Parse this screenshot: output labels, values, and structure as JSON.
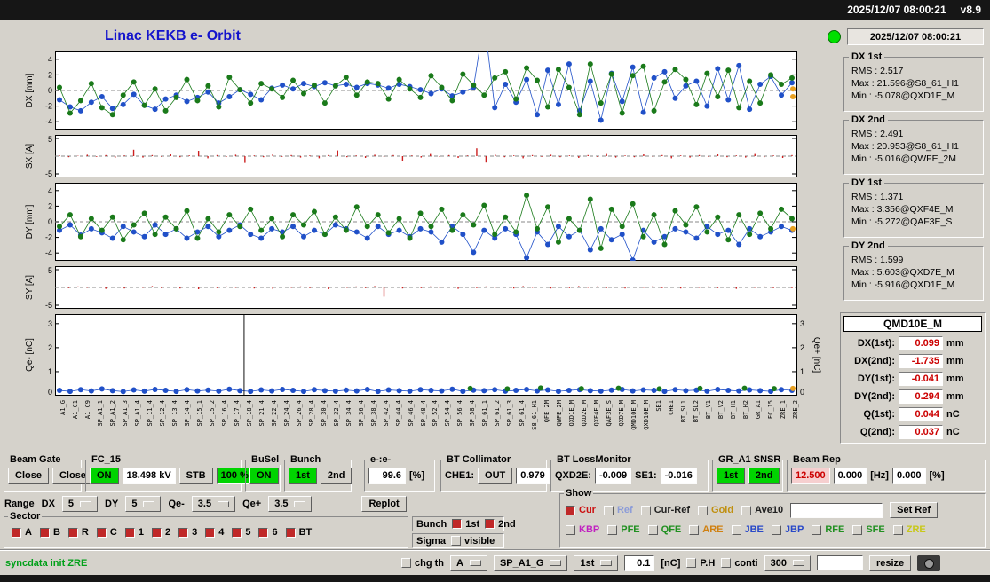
{
  "titlebar": {
    "datetime": "2025/12/07 08:00:21",
    "version": "v8.9"
  },
  "header": {
    "title": "Linac KEKB e- Orbit",
    "timestamp": "2025/12/07 08:00:21"
  },
  "stats": [
    {
      "name": "DX 1st",
      "rms": "RMS : 2.517",
      "max": "Max : 21.596@S8_61_H1",
      "min": "Min : -5.078@QXD1E_M"
    },
    {
      "name": "DX 2nd",
      "rms": "RMS : 2.491",
      "max": "Max : 20.953@S8_61_H1",
      "min": "Min : -5.016@QWFE_2M"
    },
    {
      "name": "DY 1st",
      "rms": "RMS : 1.371",
      "max": "Max : 3.356@QXF4E_M",
      "min": "Min : -5.272@QAF3E_S"
    },
    {
      "name": "DY 2nd",
      "rms": "RMS : 1.599",
      "max": "Max : 5.603@QXD7E_M",
      "min": "Min : -5.916@QXD1E_M"
    }
  ],
  "monitor": {
    "title": "QMD10E_M",
    "rows": [
      {
        "label": "DX(1st):",
        "value": "0.099",
        "unit": "mm"
      },
      {
        "label": "DX(2nd):",
        "value": "-1.735",
        "unit": "mm"
      },
      {
        "label": "DY(1st):",
        "value": "-0.041",
        "unit": "mm"
      },
      {
        "label": "DY(2nd):",
        "value": "0.294",
        "unit": "mm"
      },
      {
        "label": "Q(1st):",
        "value": "0.044",
        "unit": "nC"
      },
      {
        "label": "Q(2nd):",
        "value": "0.037",
        "unit": "nC"
      }
    ]
  },
  "controls": {
    "beam_gate": {
      "title": "Beam Gate",
      "btn1": "Close",
      "btn2": "Close"
    },
    "fc15": {
      "title": "FC_15",
      "on": "ON",
      "kv": "18.498 kV",
      "stb": "STB",
      "pct": "100 %"
    },
    "busel": {
      "title": "BuSel",
      "on": "ON"
    },
    "bunch": {
      "title": "Bunch",
      "b1": "1st",
      "b2": "2nd"
    },
    "ee": {
      "title": "e-:e-",
      "value": "99.6",
      "unit": "[%]"
    },
    "bt_collimator": {
      "title": "BT Collimator",
      "che1_label": "CHE1:",
      "che1": "OUT",
      "value": "0.979"
    },
    "bt_lossmonitor": {
      "title": "BT LossMonitor",
      "qxd2e_label": "QXD2E:",
      "qxd2e": "-0.009",
      "se1_label": "SE1:",
      "se1": "-0.016"
    },
    "gr_a1": {
      "title": "GR_A1 SNSR",
      "b1": "1st",
      "b2": "2nd"
    },
    "beam_rep": {
      "title": "Beam Rep",
      "rep": "12.500",
      "v2": "0.000",
      "hz": "[Hz]",
      "v3": "0.000",
      "pct": "[%]"
    },
    "range": {
      "label": "Range",
      "dx_label": "DX",
      "dx": "5",
      "dy_label": "DY",
      "dy": "5",
      "qem_label": "Qe-",
      "qem": "3.5",
      "qep_label": "Qe+",
      "qep": "3.5",
      "replot": "Replot"
    },
    "sector": {
      "title": "Sector",
      "items": [
        {
          "label": "A",
          "checked": true
        },
        {
          "label": "B",
          "checked": true
        },
        {
          "label": "R",
          "checked": true
        },
        {
          "label": "C",
          "checked": true
        },
        {
          "label": "1",
          "checked": true
        },
        {
          "label": "2",
          "checked": true
        },
        {
          "label": "3",
          "checked": true
        },
        {
          "label": "4",
          "checked": true
        },
        {
          "label": "5",
          "checked": true
        },
        {
          "label": "6",
          "checked": true
        },
        {
          "label": "BT",
          "checked": true
        }
      ]
    },
    "bunch_sel": {
      "title": "Bunch",
      "items": [
        {
          "label": "1st",
          "checked": true
        },
        {
          "label": "2nd",
          "checked": true
        }
      ]
    },
    "sigma": {
      "title": "Sigma",
      "items": [
        {
          "label": "visible",
          "checked": false
        }
      ]
    },
    "show": {
      "title": "Show",
      "row1": [
        {
          "label": "Cur",
          "color": "#cc1010",
          "checked": true
        },
        {
          "label": "Ref",
          "color": "#8c9cd8",
          "checked": false
        },
        {
          "label": "Cur-Ref",
          "color": "#202020",
          "checked": false
        },
        {
          "label": "Gold",
          "color": "#c09010",
          "checked": false
        },
        {
          "label": "Ave10",
          "color": "#202020",
          "checked": false
        }
      ],
      "set_ref": "Set Ref",
      "row2": [
        {
          "label": "KBP",
          "color": "#c020c0",
          "checked": false
        },
        {
          "label": "PFE",
          "color": "#209020",
          "checked": false
        },
        {
          "label": "QFE",
          "color": "#209020",
          "checked": false
        },
        {
          "label": "ARE",
          "color": "#d08010",
          "checked": false
        },
        {
          "label": "JBE",
          "color": "#2848c8",
          "checked": false
        },
        {
          "label": "JBP",
          "color": "#2848c8",
          "checked": false
        },
        {
          "label": "RFE",
          "color": "#209020",
          "checked": false
        },
        {
          "label": "SFE",
          "color": "#209020",
          "checked": false
        },
        {
          "label": "ZRE",
          "color": "#c8c818",
          "checked": false
        }
      ]
    },
    "statusbar": {
      "message": "syncdata init ZRE",
      "chg_th": "chg th",
      "mode": "A",
      "device": "SP_A1_G",
      "bunch": "1st",
      "threshold": "0.1",
      "unit": "[nC]",
      "ph": "P.H",
      "conti": "conti",
      "interval": "300",
      "resize": "resize"
    }
  },
  "xaxis_labels": [
    "A1_G",
    "A1_C1",
    "A1_C9",
    "SP_A1_1",
    "SP_A1_2",
    "SP_A1_3",
    "SP_A1_4",
    "SP_11_4",
    "SP_12_4",
    "SP_13_4",
    "SP_14_4",
    "SP_15_1",
    "SP_15_2",
    "SP_16_4",
    "SP_17_4",
    "SP_18_4",
    "SP_21_4",
    "SP_22_4",
    "SP_24_4",
    "SP_26_4",
    "SP_28_4",
    "SP_30_4",
    "SP_32_4",
    "SP_34_4",
    "SP_36_4",
    "SP_38_4",
    "SP_42_4",
    "SP_44_4",
    "SP_46_4",
    "SP_48_4",
    "SP_52_4",
    "SP_54_4",
    "SP_56_4",
    "SP_58_4",
    "SP_61_1",
    "SP_61_2",
    "SP_61_3",
    "SP_61_4",
    "S8_61_H1",
    "QFE_2M",
    "QWFE_2M",
    "QXD1E_M",
    "QXD2E_M",
    "QXF4E_M",
    "QAF3E_S",
    "QXD7E_M",
    "QMD10E_M",
    "QXD10E_M",
    "SE1",
    "CHE1",
    "BT_SL1",
    "BT_SL2",
    "BT_V1",
    "BT_V2",
    "BT_H1",
    "BT_H2",
    "GR_A1",
    "FC_15",
    "ZRE_1",
    "ZRE_2"
  ],
  "chart_data": [
    {
      "id": "dx",
      "type": "scatter",
      "axis_title": "DX [mm]",
      "ylim": [
        -5,
        5
      ],
      "yticks": [
        4,
        2,
        0,
        -2,
        -4
      ],
      "series": [
        {
          "name": "e- orbit 1st bunch",
          "color": "#2050c8",
          "values": [
            -1.2,
            -2.1,
            -2.6,
            -1.5,
            -0.8,
            -2.3,
            -1.8,
            -0.5,
            -1.9,
            -2.4,
            -1.1,
            -0.6,
            -1.4,
            -0.9,
            -0.2,
            -1.6,
            -0.8,
            0.1,
            -0.5,
            -1.2,
            0.3,
            0.7,
            0.2,
            0.9,
            0.5,
            1.0,
            0.6,
            0.8,
            0.4,
            0.9,
            0.7,
            0.3,
            0.8,
            0.5,
            0.1,
            -0.4,
            0.2,
            -0.7,
            -0.2,
            0.4,
            9.0,
            -2.2,
            0.8,
            -1.5,
            1.4,
            -3.1,
            2.6,
            -1.8,
            3.4,
            -2.6,
            1.2,
            -3.8,
            2.2,
            -1.4,
            3.0,
            -2.8,
            1.6,
            2.4,
            -1.0,
            0.6,
            1.2,
            -2.0,
            2.8,
            -1.2,
            3.2,
            -2.4,
            0.8,
            1.8,
            -0.6,
            1.0
          ]
        },
        {
          "name": "e- orbit 2nd bunch",
          "color": "#1a7a1a",
          "values": [
            0.4,
            -2.9,
            -1.3,
            0.9,
            -2.2,
            -3.1,
            -0.6,
            1.1,
            -1.9,
            0.2,
            -2.6,
            -0.9,
            1.4,
            -1.3,
            0.6,
            -2.1,
            1.7,
            0.1,
            -1.6,
            0.9,
            0.2,
            -0.9,
            1.3,
            -0.4,
            0.7,
            -1.6,
            0.6,
            1.7,
            -0.6,
            1.1,
            0.9,
            -1.1,
            1.4,
            0.2,
            -0.9,
            1.9,
            0.4,
            -1.3,
            2.1,
            0.7,
            -0.6,
            1.6,
            2.4,
            -1.1,
            2.9,
            1.3,
            -2.1,
            2.7,
            0.4,
            -3.1,
            3.4,
            -1.6,
            2.1,
            -2.9,
            1.9,
            3.1,
            -2.6,
            1.1,
            2.7,
            1.4,
            -1.8,
            2.2,
            -0.8,
            2.6,
            -2.2,
            1.2,
            -1.6,
            2.0,
            0.8,
            1.6
          ]
        }
      ],
      "end_markers": [
        0.2,
        -0.8
      ]
    },
    {
      "id": "sx",
      "type": "bar",
      "axis_title": "SX [A]",
      "ylim": [
        -6,
        6
      ],
      "yticks": [
        5,
        -5
      ],
      "color": "#cc2020",
      "bar_values": [
        0.2,
        -0.3,
        0.1,
        0.4,
        -0.2,
        0.3,
        -0.5,
        0.2,
        1.8,
        -0.4,
        0.3,
        -0.2,
        0.5,
        -0.3,
        0.2,
        1.5,
        -0.6,
        0.3,
        -0.2,
        0.4,
        -1.9,
        0.2,
        -0.3,
        0.5,
        -0.2,
        0.3,
        -0.4,
        0.2,
        -0.6,
        0.3,
        1.6,
        -0.3,
        0.2,
        -0.5,
        0.4,
        -0.2,
        0.3,
        -1.5,
        0.2,
        -0.4,
        0.6,
        -0.2,
        0.3,
        -0.5,
        0.2,
        2.2,
        -1.8,
        0.4,
        -0.3,
        0.2,
        -0.6,
        0.3,
        -0.2,
        0.4,
        -0.3,
        0.2,
        -0.5,
        0.3,
        -0.2,
        0.6,
        -0.4,
        0.2,
        -0.3,
        0.5,
        -0.2,
        0.3,
        -0.6,
        0.2,
        -0.4,
        0.3,
        -0.2,
        0.5,
        -0.3,
        0.2,
        -0.4,
        0.6,
        -0.3,
        0.2,
        -0.5,
        0.3
      ]
    },
    {
      "id": "dy",
      "type": "scatter",
      "axis_title": "DY [mm]",
      "ylim": [
        -5,
        5
      ],
      "yticks": [
        4,
        2,
        0,
        -2,
        -4
      ],
      "series": [
        {
          "name": "e- orbit 1st bunch",
          "color": "#2050c8",
          "values": [
            -1.1,
            -0.4,
            -1.7,
            -0.9,
            -1.4,
            -2.1,
            -0.6,
            -1.3,
            -1.9,
            -0.4,
            -1.6,
            -0.9,
            -2.1,
            -1.3,
            -0.6,
            -1.9,
            -1.1,
            -0.4,
            -1.6,
            -2.1,
            -0.9,
            -1.3,
            -0.6,
            -1.9,
            -1.1,
            -1.6,
            -0.4,
            -0.9,
            -1.3,
            -2.1,
            -0.6,
            -1.6,
            -1.1,
            -1.9,
            -0.9,
            -1.3,
            -2.6,
            -0.6,
            -1.6,
            -3.9,
            -1.1,
            -2.1,
            -0.9,
            -1.6,
            -4.6,
            -1.3,
            -2.9,
            -0.6,
            -1.9,
            -1.1,
            -3.6,
            -0.9,
            -2.3,
            -1.6,
            -4.9,
            -1.1,
            -2.6,
            -1.9,
            -0.9,
            -1.3,
            -2.1,
            -0.6,
            -1.6,
            -1.1,
            -2.9,
            -0.9,
            -1.9,
            -1.3,
            -0.6,
            -1.1
          ]
        },
        {
          "name": "e- orbit 2nd bunch",
          "color": "#1a7a1a",
          "values": [
            -0.6,
            0.9,
            -1.9,
            0.4,
            -1.1,
            0.6,
            -2.3,
            -0.4,
            1.1,
            -1.6,
            0.6,
            -0.9,
            1.4,
            -2.1,
            0.4,
            -1.3,
            0.9,
            -0.6,
            1.6,
            -1.1,
            0.4,
            -1.9,
            0.9,
            -0.4,
            1.3,
            -1.6,
            0.6,
            -1.1,
            1.9,
            -0.6,
            0.9,
            -1.4,
            0.4,
            -2.1,
            1.1,
            -0.6,
            1.6,
            -1.1,
            0.9,
            -0.4,
            2.1,
            -1.6,
            0.6,
            -1.3,
            3.4,
            -0.9,
            1.9,
            -2.6,
            0.4,
            -1.1,
            2.9,
            -3.4,
            1.6,
            -0.6,
            2.3,
            -1.9,
            0.9,
            -2.9,
            1.4,
            -0.4,
            1.9,
            -1.3,
            0.6,
            -2.3,
            0.9,
            -1.6,
            1.1,
            -0.9,
            1.6,
            0.4
          ]
        }
      ],
      "end_markers": [
        -0.9
      ]
    },
    {
      "id": "sy",
      "type": "bar",
      "axis_title": "SY [A]",
      "ylim": [
        -6,
        6
      ],
      "yticks": [
        5,
        -5
      ],
      "color": "#cc2020",
      "bar_values": [
        0.1,
        -0.2,
        0.3,
        -0.1,
        0.2,
        -0.4,
        0.1,
        -0.3,
        0.2,
        -0.1,
        0.4,
        -0.2,
        0.1,
        -0.3,
        0.2,
        -0.5,
        0.1,
        -0.2,
        0.3,
        -0.1,
        0.2,
        -0.3,
        0.1,
        -0.4,
        0.2,
        -0.1,
        0.3,
        -0.2,
        0.1,
        -0.5,
        0.2,
        -0.1,
        0.3,
        -0.2,
        0.4,
        -2.6,
        0.2,
        -0.3,
        0.1,
        -0.2,
        0.3,
        -0.1,
        0.2,
        -0.4,
        0.1,
        -0.2,
        0.3,
        -0.1,
        0.2,
        -0.3,
        0.4,
        -0.1,
        0.2,
        -0.3,
        0.1,
        -0.2,
        0.4,
        -0.1,
        0.3,
        -0.2,
        0.1,
        -0.3,
        0.2,
        -0.1,
        0.4,
        -0.2,
        0.1,
        -0.3,
        0.2,
        -0.1,
        0.3,
        -0.2,
        0.1,
        -0.4,
        0.2,
        -0.1,
        0.3,
        -0.2,
        0.1,
        -0.2
      ]
    },
    {
      "id": "qe",
      "type": "scatter",
      "axis_title": "Qe- [nC]",
      "right_title": "Qe+ [nC]",
      "ylim": [
        0,
        3.4
      ],
      "yticks": [
        3,
        2,
        1,
        0
      ],
      "spike_x": 0.255,
      "series": [
        {
          "name": "Qe-",
          "color": "#2050c8",
          "values": [
            0.22,
            0.18,
            0.25,
            0.2,
            0.28,
            0.21,
            0.17,
            0.24,
            0.19,
            0.26,
            0.22,
            0.18,
            0.25,
            0.2,
            0.23,
            0.19,
            0.27,
            0.21,
            0.18,
            0.24,
            0.2,
            0.26,
            0.22,
            0.18,
            0.25,
            0.21,
            0.19,
            0.23,
            0.2,
            0.26,
            0.18,
            0.24,
            0.21,
            0.19,
            0.25,
            0.22,
            0.2,
            0.27,
            0.18,
            0.23,
            0.21,
            0.25,
            0.19,
            0.22,
            0.26,
            0.2,
            0.24,
            0.18,
            0.22,
            0.25,
            0.21,
            0.19,
            0.23,
            0.26,
            0.2,
            0.24,
            0.22,
            0.18,
            0.25,
            0.21,
            0.23,
            0.19,
            0.26,
            0.22,
            0.2,
            0.24,
            0.21,
            0.18,
            0.25,
            0.22
          ]
        }
      ],
      "green_points": [
        {
          "x": 0.56,
          "y": 0.3
        },
        {
          "x": 0.61,
          "y": 0.28
        },
        {
          "x": 0.655,
          "y": 0.32
        },
        {
          "x": 0.71,
          "y": 0.29
        },
        {
          "x": 0.76,
          "y": 0.31
        },
        {
          "x": 0.815,
          "y": 0.28
        },
        {
          "x": 0.87,
          "y": 0.3
        },
        {
          "x": 0.93,
          "y": 0.31
        },
        {
          "x": 0.97,
          "y": 0.29
        }
      ],
      "end_markers": [
        0.3
      ]
    }
  ]
}
